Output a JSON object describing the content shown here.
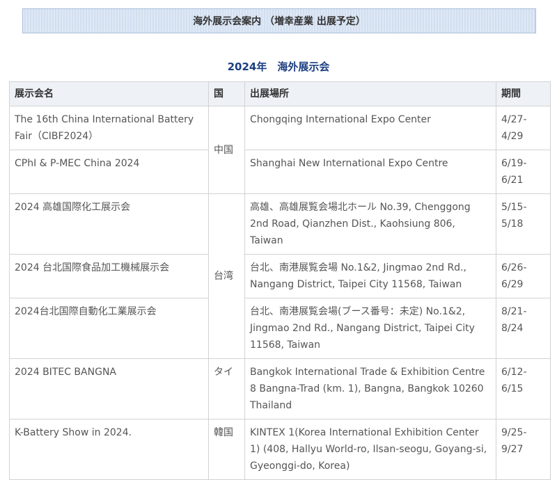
{
  "banner": {
    "title": "海外展示会案内 （増幸産業 出展予定）"
  },
  "section": {
    "title": "2024年　海外展示会"
  },
  "table": {
    "headers": [
      "展示会名",
      "国",
      "出展場所",
      "期間"
    ],
    "rows": [
      {
        "name": "The 16th China International Battery Fair（CIBF2024）",
        "country": "中国",
        "venue": "Chongqing International Expo Center",
        "period": "4/27-4/29"
      },
      {
        "name": "CPhI & P-MEC China 2024",
        "venue": "Shanghai New International Expo Centre",
        "period": "6/19-6/21"
      },
      {
        "name": "2024 高雄国際化工展示会",
        "country": "台湾",
        "venue": "高雄、高雄展覧会場北ホール No.39, Chenggong 2nd Road, Qianzhen Dist., Kaohsiung 806, Taiwan",
        "period": "5/15-5/18"
      },
      {
        "name": "2024 台北国際食品加工機械展示会",
        "venue": "台北、南港展覧会場 No.1&2, Jingmao 2nd Rd., Nangang District, Taipei City 11568, Taiwan",
        "period": "6/26-6/29"
      },
      {
        "name": "2024台北国際自動化工業展示会",
        "venue": "台北、南港展覧会場(ブース番号：未定) No.1&2, Jingmao 2nd Rd., Nangang District, Taipei City 11568, Taiwan",
        "period": "8/21-8/24"
      },
      {
        "name": "2024 BITEC BANGNA",
        "country": "タイ",
        "venue": "Bangkok International Trade & Exhibition Centre 8 Bangna-Trad (km. 1), Bangna, Bangkok 10260 Thailand",
        "period": "6/12-6/15"
      },
      {
        "name": "K-Battery Show in 2024.",
        "country": "韓国",
        "venue": "KINTEX 1(Korea International Exhibition Center 1) (408, Hallyu World-ro, Ilsan-seogu, Goyang-si, Gyeonggi-do, Korea)",
        "period": "9/25-9/27"
      }
    ]
  }
}
